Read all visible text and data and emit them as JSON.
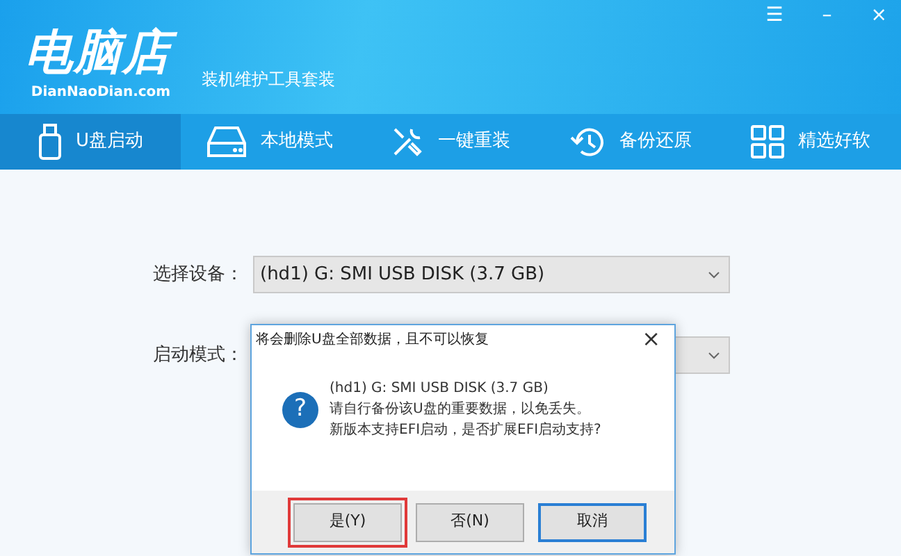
{
  "window": {
    "controls": [
      "☰",
      "–",
      "×"
    ]
  },
  "logo": {
    "name": "电脑店",
    "site": "DianNaoDian.com",
    "tagline": "装机维护工具套装"
  },
  "tabs": [
    {
      "label": "U盘启动",
      "kind": "usb",
      "selected": true
    },
    {
      "label": "本地模式",
      "kind": "drive",
      "selected": false
    },
    {
      "label": "一键重装",
      "kind": "tools",
      "selected": false
    },
    {
      "label": "备份还原",
      "kind": "restore",
      "selected": false
    },
    {
      "label": "精选好软",
      "kind": "grid",
      "selected": false
    }
  ],
  "form": [
    {
      "label": "选择设备：",
      "value": "(hd1) G: SMI USB DISK (3.7 GB)"
    },
    {
      "label": "启动模式："
    }
  ],
  "dialog": {
    "title": "将会删除U盘全部数据，且不可以恢复",
    "close": "×",
    "icon": "?",
    "lines": [
      "(hd1) G: SMI USB DISK (3.7 GB)",
      "请自行备份该U盘的重要数据，以免丢失。",
      "新版本支持EFI启动，是否扩展EFI启动支持?"
    ],
    "buttons": [
      {
        "label": "是(Y)",
        "highlighted": true,
        "focused": false
      },
      {
        "label": "否(N)",
        "highlighted": false,
        "focused": false
      },
      {
        "label": "取消",
        "highlighted": false,
        "focused": true
      }
    ]
  }
}
